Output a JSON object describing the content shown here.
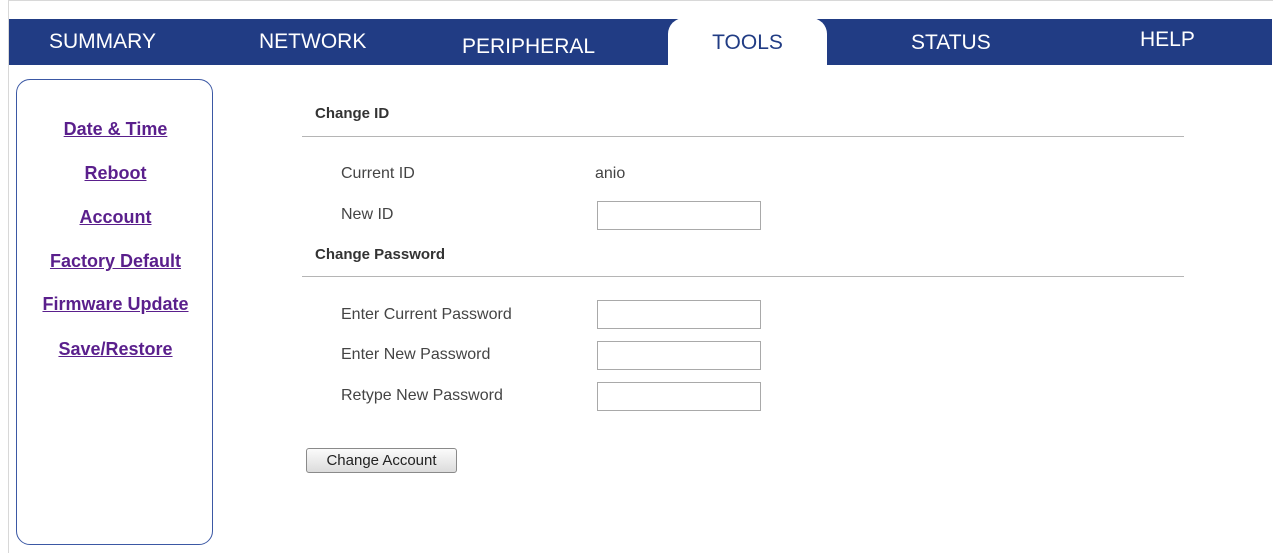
{
  "nav": {
    "tabs": [
      {
        "label": "SUMMARY"
      },
      {
        "label": "NETWORK"
      },
      {
        "label": "PERIPHERAL"
      },
      {
        "label": "TOOLS",
        "active": true
      },
      {
        "label": "STATUS"
      },
      {
        "label": "HELP"
      }
    ]
  },
  "sidebar": {
    "items": [
      {
        "label": "Date & Time"
      },
      {
        "label": "Reboot"
      },
      {
        "label": "Account"
      },
      {
        "label": "Factory Default"
      },
      {
        "label": "Firmware Update"
      },
      {
        "label": "Save/Restore"
      }
    ]
  },
  "change_id": {
    "title": "Change ID",
    "current_id_label": "Current ID",
    "current_id_value": "anio",
    "new_id_label": "New ID",
    "new_id_value": ""
  },
  "change_password": {
    "title": "Change Password",
    "current_label": "Enter Current Password",
    "current_value": "",
    "new_label": "Enter New Password",
    "new_value": "",
    "retype_label": "Retype New Password",
    "retype_value": ""
  },
  "actions": {
    "change_account_label": "Change Account"
  },
  "colors": {
    "nav_background": "#213c84",
    "link": "#5a1f8c",
    "sidebar_border": "#3b58a4"
  }
}
